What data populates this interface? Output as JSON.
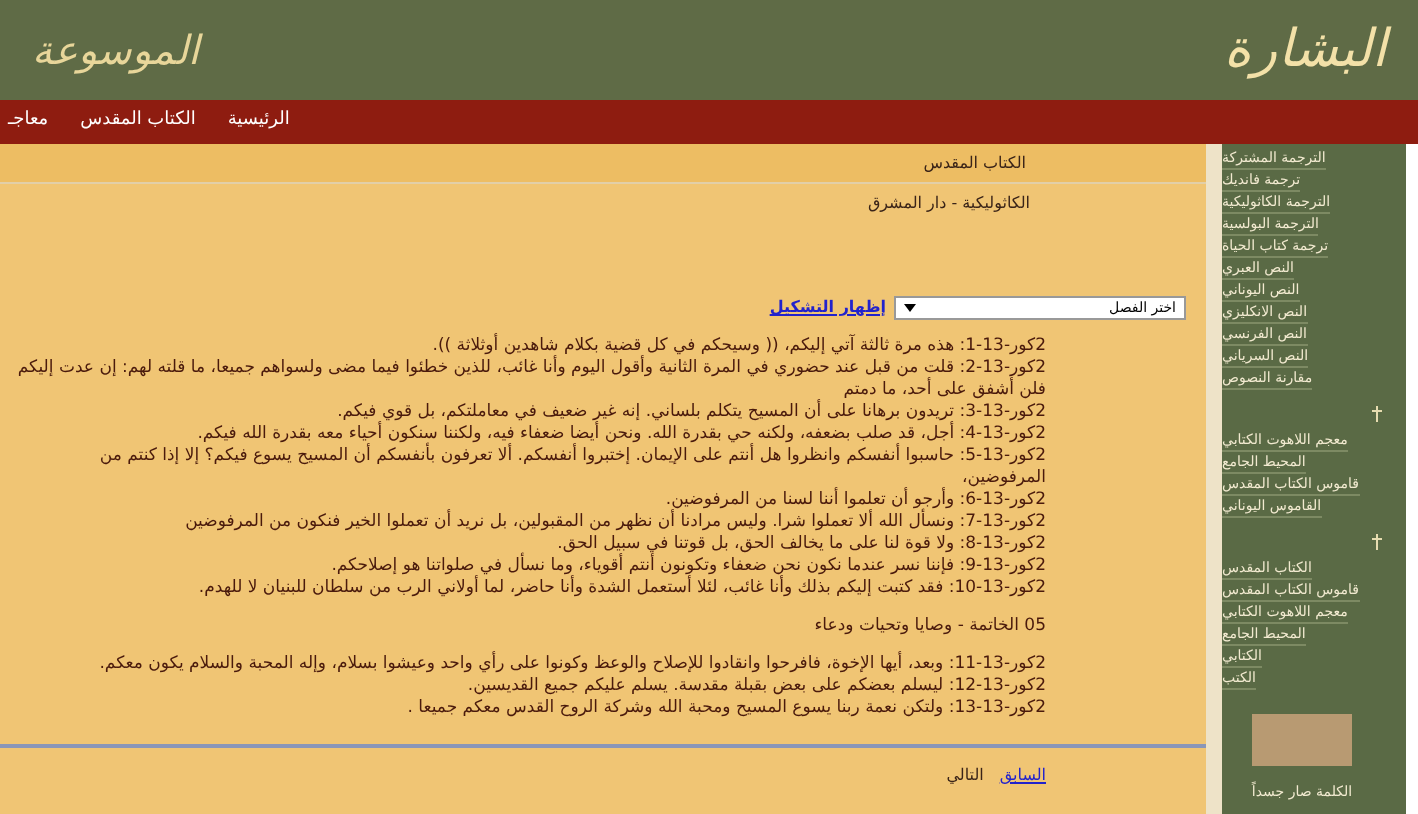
{
  "header": {
    "logo_right": "البشارة",
    "logo_left": "الموسوعة"
  },
  "nav": [
    "الرئيسية",
    "الكتاب المقدس",
    "معاجـ"
  ],
  "breadcrumb": "الكتاب المقدس",
  "subtitle": "الكاثوليكية - دار المشرق",
  "chapter_select": {
    "value": "اختر الفصل"
  },
  "toggle_link": "إظهار التشكيل",
  "sections": [
    {
      "kind": "verses",
      "items": [
        "2كور-13-1: هذه مرة ثالثة آتي إليكم، (( وسيحكم في كل قضية بكلام شاهدين أوثلاثة )).",
        "2كور-13-2: قلت من قبل عند حضوري في المرة الثانية وأقول اليوم وأنا غائب، للذين خطئوا فيما مضى ولسواهم جميعا، ما قلته لهم: إن عدت إليكم فلن أشفق على أحد، ما دمتم",
        "2كور-13-3: تريدون برهانا على أن المسيح يتكلم بلساني. إنه غير ضعيف في معاملتكم، بل قوي فيكم.",
        "2كور-13-4: أجل، قد صلب بضعفه، ولكنه حي بقدرة الله. ونحن أيضا ضعفاء فيه، ولكننا سنكون أحياء معه بقدرة الله فيكم.",
        "2كور-13-5: حاسبوا أنفسكم وانظروا هل أنتم على الإيمان. إختبروا أنفسكم. ألا تعرفون بأنفسكم أن المسيح يسوع فيكم؟ إلا إذا كنتم من المرفوضين،",
        "2كور-13-6: وأرجو أن تعلموا أننا لسنا من المرفوضين.",
        "2كور-13-7: ونسأل الله ألا تعملوا شرا. وليس مرادنا أن نظهر من المقبولين، بل نريد أن تعملوا الخير فنكون من المرفوضين",
        "2كور-13-8: ولا قوة لنا على ما يخالف الحق، بل قوتنا في سبيل الحق.",
        "2كور-13-9: فإننا نسر عندما نكون نحن ضعفاء وتكونون أنتم أقوياء، وما نسأل في صلواتنا هو إصلاحكم.",
        "2كور-13-10: فقد كتبت إليكم بذلك وأنا غائب، لئلا أستعمل الشدة وأنا حاضر، لما أولاني الرب من سلطان للبنيان لا للهدم."
      ]
    },
    {
      "kind": "heading",
      "text": "05 الخاتمة - وصايا وتحيات ودعاء"
    },
    {
      "kind": "verses",
      "items": [
        "2كور-13-11: وبعد، أيها الإخوة، فافرحوا وانقادوا للإصلاح والوعظ وكونوا على رأي واحد وعيشوا بسلام، وإله المحبة والسلام يكون معكم.",
        "2كور-13-12: ليسلم بعضكم على بعض بقبلة مقدسة. يسلم عليكم جميع القديسين.",
        "2كور-13-13: ولتكن نعمة ربنا يسوع المسيح ومحبة الله وشركة الروح القدس معكم جميعا ."
      ]
    }
  ],
  "pager": {
    "previous": "السابق",
    "next": "التالي"
  },
  "sidebar": {
    "groups": [
      [
        "الترجمة المشتركة",
        "ترجمة فانديك",
        "الترجمة الكاثوليكية",
        "الترجمة البولسية",
        "ترجمة كتاب الحياة",
        "النص العبري",
        "النص اليوناني",
        "النص الانكليزي",
        "النص الفرنسي",
        "النص السرياني",
        "مقارنة النصوص"
      ],
      [
        "معجم اللاهوت الكتابي",
        "المحيط الجامع",
        "قاموس الكتاب المقدس",
        "القاموس اليوناني"
      ],
      [
        "الكتاب المقدس",
        "قاموس الكتاب المقدس",
        "معجم اللاهوت الكتابي",
        "المحيط الجامع",
        "الكتابي",
        "الكتب"
      ]
    ],
    "caption": "الكلمة صار جسداً"
  }
}
